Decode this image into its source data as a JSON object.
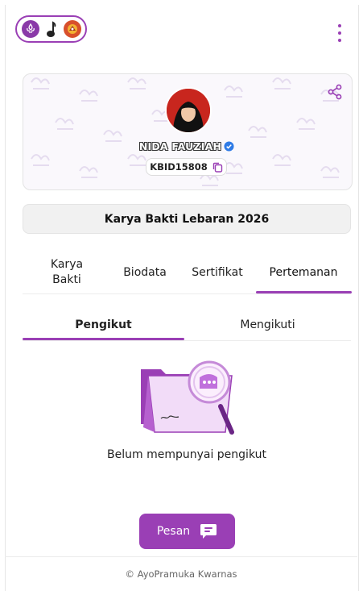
{
  "header": {
    "logos": [
      "scout-emblem-icon",
      "tunas-kelapa-icon",
      "kwarnas-crest-icon"
    ],
    "menu_icon": "more-vertical-icon"
  },
  "profile": {
    "name": "NIDA FAUZIAH",
    "verified": true,
    "member_id": "KBID15808",
    "share_icon": "share-icon",
    "copy_icon": "copy-icon"
  },
  "event": {
    "title": "Karya Bakti Lebaran 2026"
  },
  "tabs": [
    {
      "label": "Karya\nBakti",
      "active": false
    },
    {
      "label": "Biodata",
      "active": false
    },
    {
      "label": "Sertifikat",
      "active": false
    },
    {
      "label": "Pertemanan",
      "active": true
    }
  ],
  "subtabs": [
    {
      "label": "Pengikut",
      "active": true
    },
    {
      "label": "Mengikuti",
      "active": false
    }
  ],
  "empty_state": {
    "message": "Belum mempunyai pengikut"
  },
  "actions": {
    "message_button": "Pesan"
  },
  "footer": {
    "text": "© AyoPramuka Kwarnas"
  },
  "colors": {
    "accent": "#9a3fb5",
    "accent_light": "#e7c9f2",
    "verified": "#2f7be6"
  }
}
